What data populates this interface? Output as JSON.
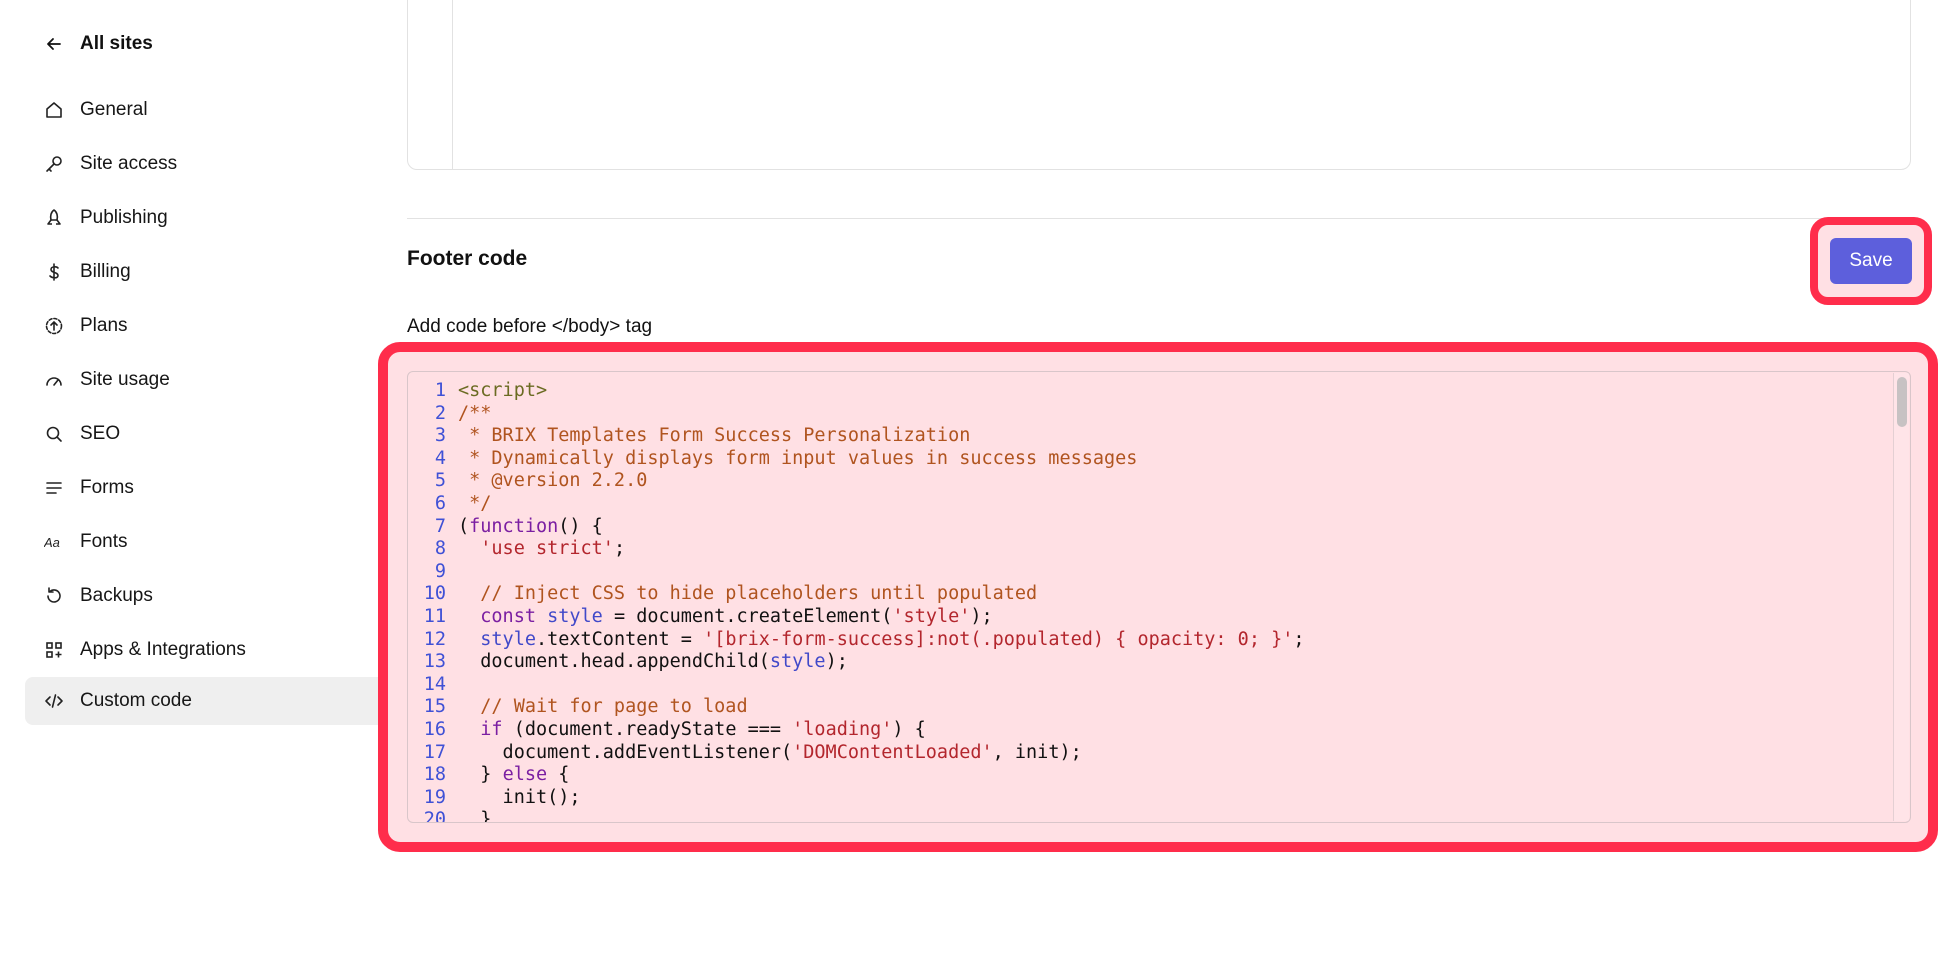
{
  "sidebar": {
    "back_label": "All sites",
    "items": [
      {
        "label": "General",
        "icon": "home-icon"
      },
      {
        "label": "Site access",
        "icon": "key-icon"
      },
      {
        "label": "Publishing",
        "icon": "rocket-icon"
      },
      {
        "label": "Billing",
        "icon": "dollar-icon"
      },
      {
        "label": "Plans",
        "icon": "upgrade-circle-icon"
      },
      {
        "label": "Site usage",
        "icon": "gauge-icon"
      },
      {
        "label": "SEO",
        "icon": "search-icon"
      },
      {
        "label": "Forms",
        "icon": "lines-icon"
      },
      {
        "label": "Fonts",
        "icon": "font-icon"
      },
      {
        "label": "Backups",
        "icon": "restore-icon"
      },
      {
        "label": "Apps & Integrations",
        "icon": "apps-icon"
      },
      {
        "label": "Custom code",
        "icon": "code-icon",
        "active": true
      }
    ]
  },
  "footer_section": {
    "title": "Footer code",
    "save_label": "Save",
    "hint": "Add code before </body> tag"
  },
  "code_lines": [
    {
      "n": "1",
      "segments": [
        {
          "t": "tag",
          "v": "<script>"
        }
      ]
    },
    {
      "n": "2",
      "segments": [
        {
          "t": "comment",
          "v": "/**"
        }
      ]
    },
    {
      "n": "3",
      "segments": [
        {
          "t": "comment",
          "v": " * BRIX Templates Form Success Personalization"
        }
      ]
    },
    {
      "n": "4",
      "segments": [
        {
          "t": "comment",
          "v": " * Dynamically displays form input values in success messages"
        }
      ]
    },
    {
      "n": "5",
      "segments": [
        {
          "t": "comment",
          "v": " * @version 2.2.0"
        }
      ]
    },
    {
      "n": "6",
      "segments": [
        {
          "t": "comment",
          "v": " */"
        }
      ]
    },
    {
      "n": "7",
      "segments": [
        {
          "t": "plain",
          "v": "("
        },
        {
          "t": "keyword",
          "v": "function"
        },
        {
          "t": "plain",
          "v": "() {"
        }
      ]
    },
    {
      "n": "8",
      "segments": [
        {
          "t": "plain",
          "v": "  "
        },
        {
          "t": "string",
          "v": "'use strict'"
        },
        {
          "t": "plain",
          "v": ";"
        }
      ]
    },
    {
      "n": "9",
      "segments": [
        {
          "t": "plain",
          "v": ""
        }
      ]
    },
    {
      "n": "10",
      "segments": [
        {
          "t": "comment",
          "v": "  // Inject CSS to hide placeholders until populated"
        }
      ]
    },
    {
      "n": "11",
      "segments": [
        {
          "t": "plain",
          "v": "  "
        },
        {
          "t": "keyword",
          "v": "const"
        },
        {
          "t": "plain",
          "v": " "
        },
        {
          "t": "var",
          "v": "style"
        },
        {
          "t": "plain",
          "v": " = document.createElement("
        },
        {
          "t": "string",
          "v": "'style'"
        },
        {
          "t": "plain",
          "v": ");"
        }
      ]
    },
    {
      "n": "12",
      "segments": [
        {
          "t": "plain",
          "v": "  "
        },
        {
          "t": "var",
          "v": "style"
        },
        {
          "t": "plain",
          "v": ".textContent = "
        },
        {
          "t": "string",
          "v": "'[brix-form-success]:not(.populated) { opacity: 0; }'"
        },
        {
          "t": "plain",
          "v": ";"
        }
      ]
    },
    {
      "n": "13",
      "segments": [
        {
          "t": "plain",
          "v": "  document.head.appendChild("
        },
        {
          "t": "var",
          "v": "style"
        },
        {
          "t": "plain",
          "v": ");"
        }
      ]
    },
    {
      "n": "14",
      "segments": [
        {
          "t": "plain",
          "v": ""
        }
      ]
    },
    {
      "n": "15",
      "segments": [
        {
          "t": "comment",
          "v": "  // Wait for page to load"
        }
      ]
    },
    {
      "n": "16",
      "segments": [
        {
          "t": "plain",
          "v": "  "
        },
        {
          "t": "keyword",
          "v": "if"
        },
        {
          "t": "plain",
          "v": " (document.readyState === "
        },
        {
          "t": "string",
          "v": "'loading'"
        },
        {
          "t": "plain",
          "v": ") {"
        }
      ]
    },
    {
      "n": "17",
      "segments": [
        {
          "t": "plain",
          "v": "    document.addEventListener("
        },
        {
          "t": "string",
          "v": "'DOMContentLoaded'"
        },
        {
          "t": "plain",
          "v": ", init);"
        }
      ]
    },
    {
      "n": "18",
      "segments": [
        {
          "t": "plain",
          "v": "  } "
        },
        {
          "t": "keyword",
          "v": "else"
        },
        {
          "t": "plain",
          "v": " {"
        }
      ]
    },
    {
      "n": "19",
      "segments": [
        {
          "t": "plain",
          "v": "    init();"
        }
      ]
    },
    {
      "n": "20",
      "segments": [
        {
          "t": "plain",
          "v": "  }"
        }
      ]
    }
  ],
  "colors": {
    "accent": "#5d5fdc",
    "highlight": "#ff2d4b",
    "active_bg": "#efefef"
  }
}
